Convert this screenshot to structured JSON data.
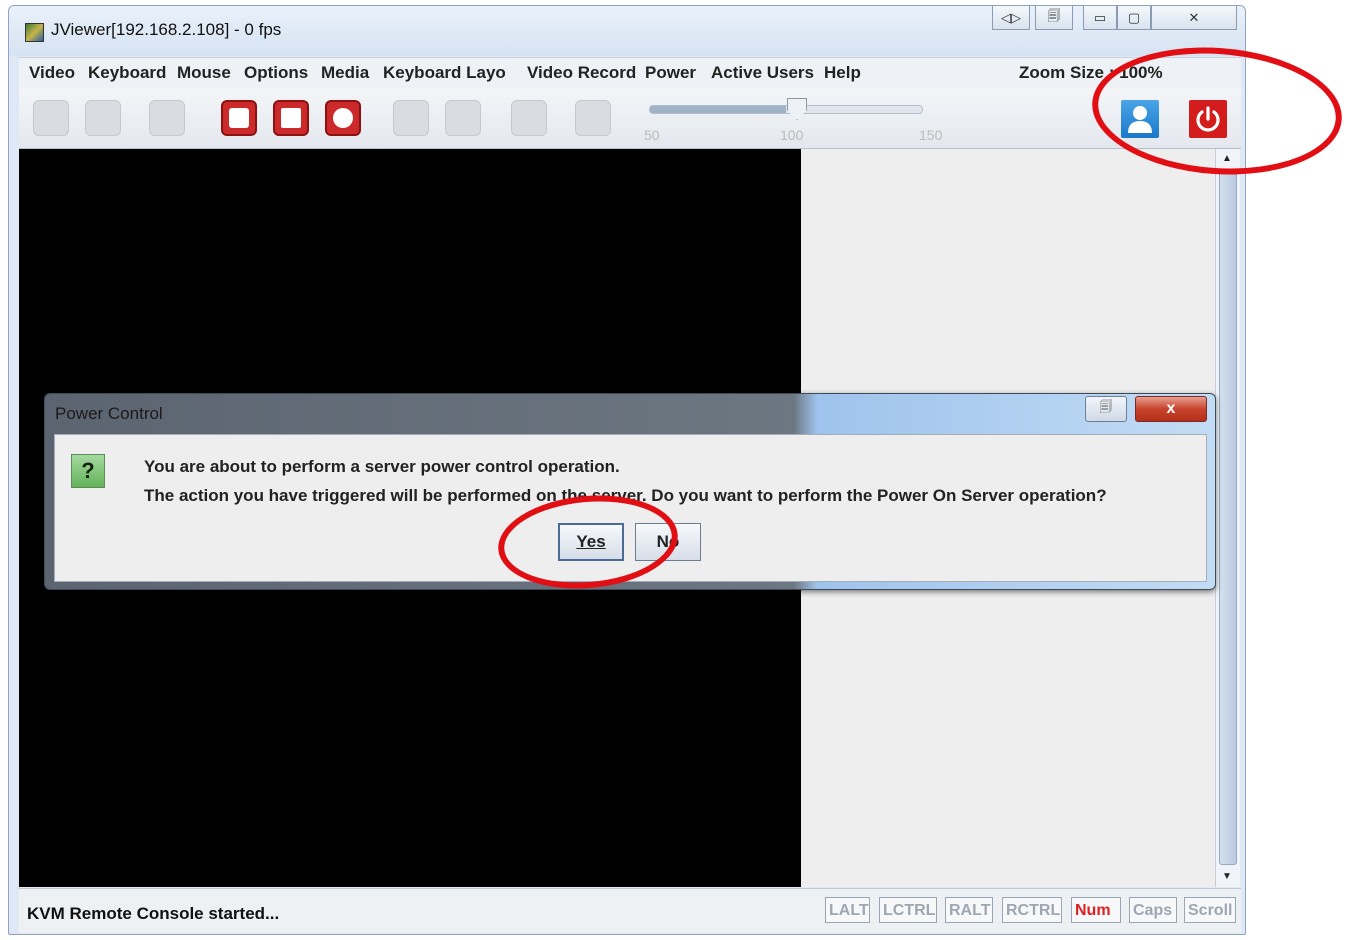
{
  "window": {
    "title": "JViewer[192.168.2.108] - 0 fps",
    "controls": [
      "◁▷",
      "🗐",
      "▭",
      "▢",
      "✕"
    ]
  },
  "menubar": {
    "items": [
      "Video",
      "Keyboard",
      "Mouse",
      "Options",
      "Media",
      "Keyboard Layout",
      "Video Record",
      "Power",
      "Active Users",
      "Help"
    ],
    "zoom_label": "Zoom Size : 100%"
  },
  "toolbar": {
    "slider": {
      "value": 100,
      "min_label": "50",
      "mid_label": "100",
      "max_label": "150"
    },
    "user_icon": "user-icon",
    "power_icon": "power-icon"
  },
  "dialog": {
    "title": "Power Control",
    "icon": "question-icon",
    "icon_glyph": "?",
    "message_line1": "You are about to perform a server power control operation.",
    "message_line2": "The action you have triggered will be performed on the server. Do you want to perform the Power On Server operation?",
    "yes_label": "Yes",
    "no_label": "No",
    "close_glyph": "x"
  },
  "statusbar": {
    "text": "KVM Remote Console started...",
    "keys": [
      {
        "label": "LALT",
        "on": false
      },
      {
        "label": "LCTRL",
        "on": false
      },
      {
        "label": "RALT",
        "on": false
      },
      {
        "label": "RCTRL",
        "on": false
      },
      {
        "label": "Num",
        "on": true
      },
      {
        "label": "Caps",
        "on": false
      },
      {
        "label": "Scroll",
        "on": false
      }
    ]
  },
  "annotation_color": "#e10f14"
}
